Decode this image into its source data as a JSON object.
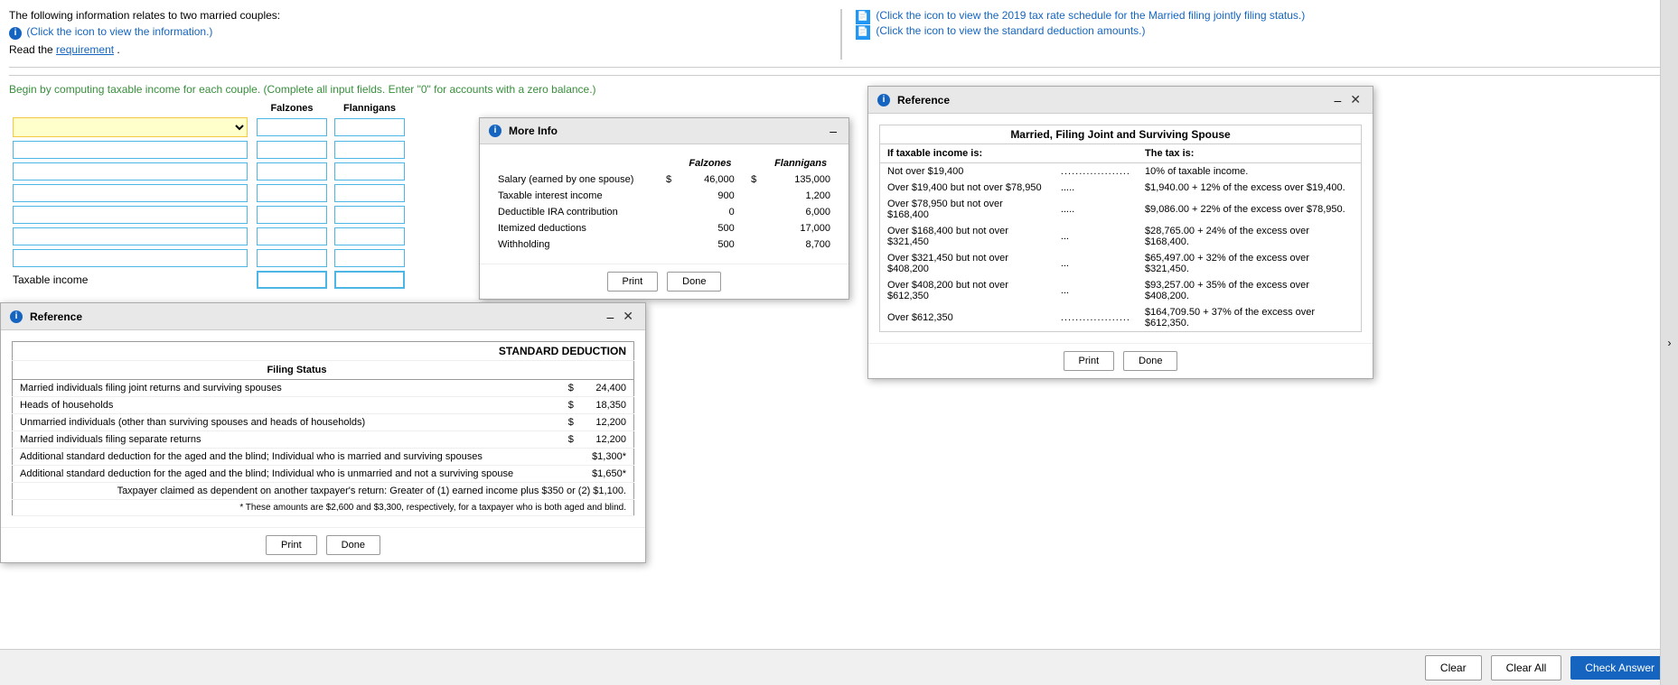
{
  "page": {
    "intro_line1": "The following information relates to two married couples:",
    "intro_info_icon": "i",
    "intro_info_link": "(Click the icon to view the information.)",
    "intro_read": "Read the",
    "intro_requirement": "requirement",
    "intro_period": ".",
    "compute_label": "Begin by computing taxable income for each couple.",
    "compute_hint": "(Complete all input fields. Enter \"0\" for accounts with a zero balance.)"
  },
  "top_right": {
    "link1": "(Click the icon to view the 2019 tax rate schedule for the Married filing jointly filing status.)",
    "link2": "(Click the icon to view the standard deduction amounts.)"
  },
  "columns": {
    "falzones": "Falzones",
    "flannigans": "Flannigans"
  },
  "rows": [
    {
      "label": "",
      "falzones": "",
      "flannigans": "",
      "is_dropdown": true
    },
    {
      "label": "",
      "falzones": "",
      "flannigans": ""
    },
    {
      "label": "",
      "falzones": "",
      "flannigans": ""
    },
    {
      "label": "",
      "falzones": "",
      "flannigans": ""
    },
    {
      "label": "",
      "falzones": "",
      "flannigans": ""
    },
    {
      "label": "",
      "falzones": "",
      "flannigans": ""
    },
    {
      "label": "",
      "falzones": "",
      "flannigans": ""
    },
    {
      "label": "Taxable income",
      "falzones": "",
      "flannigans": ""
    }
  ],
  "more_info": {
    "title": "More Info",
    "header_col1": "Falzones",
    "header_col2": "Flannigans",
    "rows": [
      {
        "label": "Salary (earned by one spouse)",
        "dollar": "$",
        "falzones": "46,000",
        "dollar2": "$",
        "flannigans": "135,000"
      },
      {
        "label": "Taxable interest income",
        "dollar": "",
        "falzones": "900",
        "dollar2": "",
        "flannigans": "1,200"
      },
      {
        "label": "Deductible IRA contribution",
        "dollar": "",
        "falzones": "0",
        "dollar2": "",
        "flannigans": "6,000"
      },
      {
        "label": "Itemized deductions",
        "dollar": "",
        "falzones": "500",
        "dollar2": "",
        "flannigans": "17,000"
      },
      {
        "label": "Withholding",
        "dollar": "",
        "falzones": "500",
        "dollar2": "",
        "flannigans": "8,700"
      }
    ],
    "btn_print": "Print",
    "btn_done": "Done"
  },
  "ref_standard": {
    "title": "Reference",
    "table_title": "STANDARD DEDUCTION",
    "filing_status_header": "Filing Status",
    "rows": [
      {
        "label": "Married individuals filing joint returns and surviving spouses",
        "dollar": "$",
        "amount": "24,400"
      },
      {
        "label": "Heads of households",
        "dollar": "$",
        "amount": "18,350"
      },
      {
        "label": "Unmarried individuals (other than surviving spouses and heads of households)",
        "dollar": "$",
        "amount": "12,200"
      },
      {
        "label": "Married individuals filing separate returns",
        "dollar": "$",
        "amount": "12,200"
      },
      {
        "label": "Additional standard deduction for the aged and the blind; Individual who is married and surviving spouses",
        "dollar": "",
        "amount": "$1,300*"
      },
      {
        "label": "Additional standard deduction for the aged and the blind; Individual who is unmarried and not a surviving spouse",
        "dollar": "",
        "amount": "$1,650*"
      },
      {
        "label": "Taxpayer claimed as dependent on another taxpayer's return: Greater of (1) earned income plus $350 or (2) $1,100.",
        "dollar": "",
        "amount": ""
      }
    ],
    "footnote": "* These amounts are $2,600 and $3,300, respectively, for a taxpayer who is both aged and blind.",
    "btn_print": "Print",
    "btn_done": "Done"
  },
  "ref_tax": {
    "title": "Reference",
    "table_title": "Married, Filing Joint and Surviving Spouse",
    "col1": "If taxable income is:",
    "col2": "The tax is:",
    "rows": [
      {
        "range": "Not over $19,400",
        "dots": "...................",
        "tax": "10% of taxable income."
      },
      {
        "range": "Over $19,400 but not over $78,950",
        "dots": ".....",
        "tax": "$1,940.00 + 12% of the excess over $19,400."
      },
      {
        "range": "Over $78,950 but not over $168,400",
        "dots": ".....",
        "tax": "$9,086.00 + 22% of the excess over $78,950."
      },
      {
        "range": "Over $168,400 but not over $321,450",
        "dots": "...",
        "tax": "$28,765.00 + 24% of the excess over $168,400."
      },
      {
        "range": "Over $321,450 but not over $408,200",
        "dots": "...",
        "tax": "$65,497.00 + 32% of the excess over $321,450."
      },
      {
        "range": "Over $408,200 but not over $612,350",
        "dots": "...",
        "tax": "$93,257.00 + 35% of the excess over $408,200."
      },
      {
        "range": "Over $612,350",
        "dots": "...................",
        "tax": "$164,709.50 + 37% of the excess over $612,350."
      }
    ],
    "btn_print": "Print",
    "btn_done": "Done"
  },
  "bottom": {
    "clear_btn": "Clear",
    "clear_all_btn": "Clear All",
    "check_answer_btn": "Check Answer"
  }
}
